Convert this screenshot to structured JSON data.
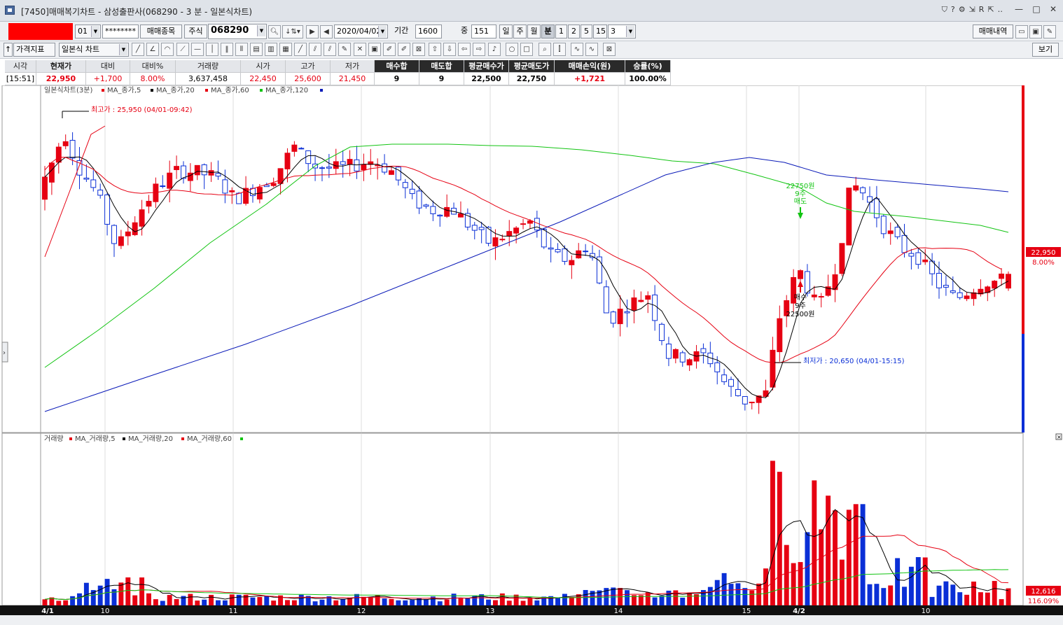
{
  "window": {
    "title": "[7450]매매복기차트 - 삼성출판사(068290 - 3 분 - 일본식차트)",
    "tools": [
      "⛉",
      "?",
      "⚙",
      "⇲",
      "R",
      "⇱",
      "‥"
    ],
    "minimize": "—",
    "maximize": "□",
    "close": "✕"
  },
  "toolbar": {
    "account_slot": "01",
    "password_mask": "********",
    "trade_items_btn": "매매종목",
    "market_type": "주식",
    "code": "068290",
    "date": "2020/04/02",
    "period_label": "기간",
    "period_value": "1600",
    "count_label": "중",
    "count_value": "151",
    "intervals": [
      "일",
      "주",
      "월",
      "분",
      "1",
      "2",
      "5",
      "15"
    ],
    "active_interval": "분",
    "minute_value": "3",
    "trade_history_btn": "매매내역",
    "indicator_btn": "가격지표",
    "chart_type": "일본식 차트",
    "view_btn": "보기"
  },
  "quote_table": {
    "headers": [
      "시각",
      "현재가",
      "대비",
      "대비%",
      "거래량",
      "시가",
      "고가",
      "저가",
      "매수합",
      "매도합",
      "평균매수가",
      "평균매도가",
      "매매손익(원)",
      "승률(%)"
    ],
    "values": [
      "[15:51]",
      "22,950",
      "+1,700",
      "8.00%",
      "3,637,458",
      "22,450",
      "25,600",
      "21,450",
      "9",
      "9",
      "22,500",
      "22,750",
      "+1,721",
      "100.00%"
    ]
  },
  "colors": {
    "up": "#e60012",
    "down": "#0a2fd6",
    "ma5": "#000000",
    "ma20": "#e60012",
    "ma60": "#12c412",
    "ma120": "#0a1ab8",
    "buy_marker": "#e60012",
    "sell_marker": "#12c412"
  },
  "price_chart": {
    "legend_title": "일본식차트(3분)",
    "legend_items": [
      {
        "label": "MA_종가,5",
        "color": "#e60012"
      },
      {
        "label": "MA_종가,20",
        "color": "#000000"
      },
      {
        "label": "MA_종가,60",
        "color": "#e60012"
      },
      {
        "label": "MA_종가,120",
        "color": "#12c412"
      }
    ],
    "legend_tail_color": "#0a1ab8",
    "high_annotation": "최고가 : 25,950 (04/01-09:42)",
    "low_annotation": "최저가 : 20,650 (04/01-15:15)",
    "buy_annotation": [
      "매수",
      "9주",
      "22500원"
    ],
    "sell_annotation": [
      "22750원",
      "9주",
      "매도"
    ],
    "current_price_label": "22,950",
    "current_pct_label": "8.00%"
  },
  "volume_chart": {
    "legend_title": "거래량",
    "legend_items": [
      {
        "label": "MA_거래량,5",
        "color": "#e60012"
      },
      {
        "label": "MA_거래량,20",
        "color": "#000000"
      },
      {
        "label": "MA_거래량,60",
        "color": "#e60012"
      }
    ],
    "legend_tail_color": "#12c412",
    "current_volume_label": "12,616",
    "current_pct_label": "116.09%"
  },
  "x_axis": {
    "labels": [
      "4/1",
      "10",
      "11",
      "12",
      "13",
      "14",
      "15",
      "4/2",
      "10"
    ]
  }
}
